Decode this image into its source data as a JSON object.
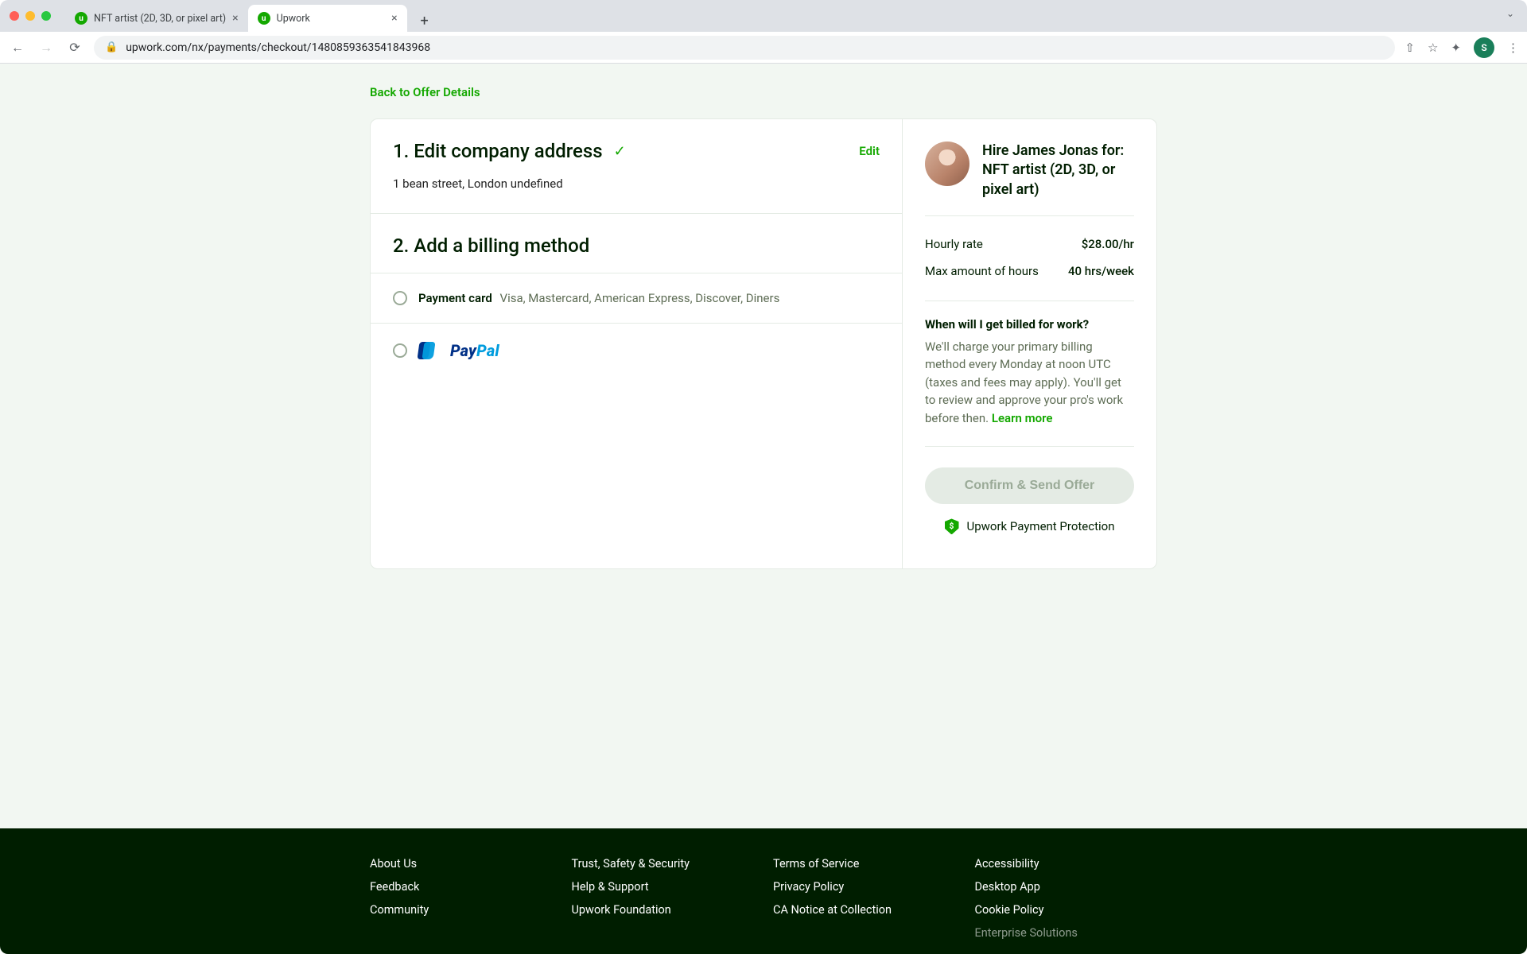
{
  "browser": {
    "tabs": [
      {
        "title": "NFT artist (2D, 3D, or pixel art)",
        "active": false
      },
      {
        "title": "Upwork",
        "active": true
      }
    ],
    "url": "upwork.com/nx/payments/checkout/1480859363541843968",
    "avatar_initial": "S"
  },
  "page": {
    "title": "Hire James Jonas",
    "back_link": "Back to Offer Details"
  },
  "step1": {
    "title": "1. Edit company address",
    "edit_label": "Edit",
    "address": "1 bean street, London undefined"
  },
  "step2": {
    "title": "2. Add a billing method",
    "options": {
      "card": {
        "label": "Payment card",
        "sub": "Visa, Mastercard, American Express, Discover, Diners"
      },
      "paypal": {
        "brand1": "Pay",
        "brand2": "Pal"
      }
    }
  },
  "summary": {
    "title": "Hire James Jonas for: NFT artist (2D, 3D, or pixel art)",
    "rows": [
      {
        "label": "Hourly rate",
        "value": "$28.00/hr"
      },
      {
        "label": "Max amount of hours",
        "value": "40 hrs/week"
      }
    ],
    "billing": {
      "q": "When will I get billed for work?",
      "p": "We'll charge your primary billing method every Monday at noon UTC (taxes and fees may apply). You'll get to review and approve your pro's work before then.",
      "learn_more": "Learn more"
    },
    "confirm_label": "Confirm & Send Offer",
    "protection_label": "Upwork Payment Protection",
    "shield_glyph": "$"
  },
  "footer": {
    "cols": [
      [
        "About Us",
        "Feedback",
        "Community"
      ],
      [
        "Trust, Safety & Security",
        "Help & Support",
        "Upwork Foundation"
      ],
      [
        "Terms of Service",
        "Privacy Policy",
        "CA Notice at Collection"
      ],
      [
        "Accessibility",
        "Desktop App",
        "Cookie Policy",
        "Enterprise Solutions"
      ]
    ]
  }
}
